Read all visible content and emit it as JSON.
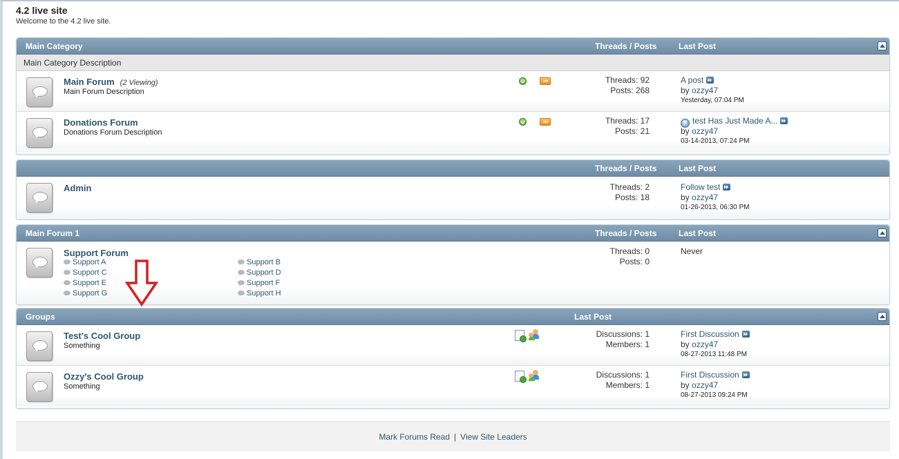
{
  "site": {
    "title": "4.2 live site",
    "description": "Welcome to the 4.2 live site."
  },
  "headers": {
    "threads_posts": "Threads / Posts",
    "last_post": "Last Post"
  },
  "main_category": {
    "title": "Main Category",
    "description": "Main Category Description",
    "forums": [
      {
        "name": "Main Forum",
        "viewing": "(2 Viewing)",
        "description": "Main Forum Description",
        "threads": "Threads: 92",
        "posts": "Posts: 268",
        "last_post_title": "A post",
        "last_post_by": "by ",
        "last_post_user": "ozzy47",
        "last_post_date": "Yesterday, 07:04 PM"
      },
      {
        "name": "Donations Forum",
        "viewing": "",
        "description": "Donations Forum Description",
        "threads": "Threads: 17",
        "posts": "Posts: 21",
        "last_post_title": "test Has Just Made A...",
        "last_post_by": "by ",
        "last_post_user": "ozzy47",
        "last_post_date": "03-14-2013, 07:24 PM"
      }
    ]
  },
  "admin_category": {
    "title": "",
    "forums": [
      {
        "name": "Admin",
        "threads": "Threads: 2",
        "posts": "Posts: 18",
        "last_post_title": "Follow test",
        "last_post_by": "by ",
        "last_post_user": "ozzy47",
        "last_post_date": "01-26-2013, 06:30 PM"
      }
    ]
  },
  "main_forum_1": {
    "title": "Main Forum 1",
    "forums": [
      {
        "name": "Support Forum",
        "threads": "Threads: 0",
        "posts": "Posts: 0",
        "last_post": "Never",
        "subforums": [
          "Support A",
          "Support B",
          "Support C",
          "Support D",
          "Support E",
          "Support F",
          "Support G",
          "Support H"
        ]
      }
    ]
  },
  "groups": {
    "title": "Groups",
    "last_post_header": "Last Post",
    "items": [
      {
        "name": "Test's Cool Group",
        "description": "Something",
        "discussions": "Discussions: 1",
        "members": "Members: 1",
        "last_post_title": "First Discussion",
        "last_post_by": "by ",
        "last_post_user": "ozzy47",
        "last_post_date": "08-27-2013 11:48 PM"
      },
      {
        "name": "Ozzy's Cool Group",
        "description": "Something",
        "discussions": "Discussions: 1",
        "members": "Members: 1",
        "last_post_title": "First Discussion",
        "last_post_by": "by ",
        "last_post_user": "ozzy47",
        "last_post_date": "08-27-2013 09:24 PM"
      }
    ]
  },
  "footer": {
    "mark_read": "Mark Forums Read",
    "separator": "|",
    "site_leaders": "View Site Leaders"
  },
  "colors": {
    "accent": "#30566f",
    "header_bar": "#7592ab",
    "arrow": "#d42020"
  },
  "icons": {
    "forum": "forum-bubble-icon",
    "online": "check-circle-icon",
    "rss": "rss-icon",
    "go": "goto-last-post-icon",
    "question": "question-icon",
    "subforum": "subforum-bubble-icon",
    "group_discussion": "discussion-icon",
    "group_members": "members-icon",
    "annotation": "red-arrow-down-icon"
  }
}
